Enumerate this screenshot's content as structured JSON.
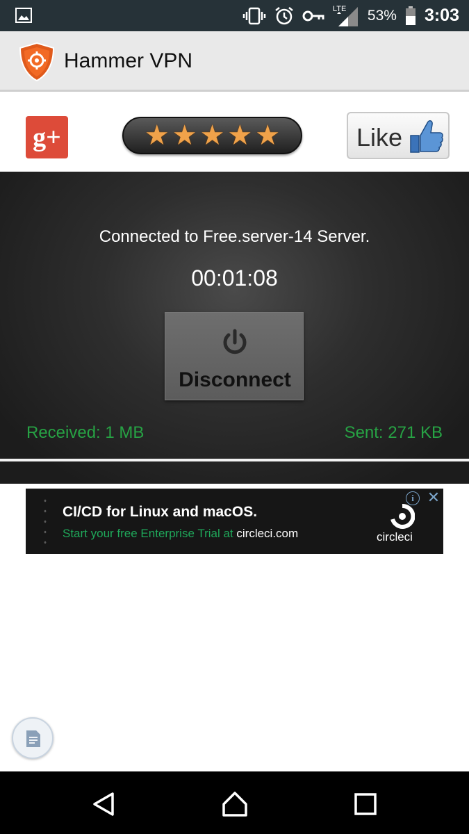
{
  "status_bar": {
    "battery": "53%",
    "time": "3:03",
    "network": "LTE"
  },
  "app": {
    "title": "Hammer VPN"
  },
  "social": {
    "gplus_label": "g+",
    "like_label": "Like",
    "rating_stars": 5
  },
  "connection": {
    "status": "Connected to Free.server-14 Server.",
    "timer": "00:01:08",
    "button_label": "Disconnect",
    "received": "Received: 1 MB",
    "sent": "Sent: 271 KB"
  },
  "ad": {
    "title": "CI/CD for Linux and macOS.",
    "subtitle_prefix": "Start your free Enterprise Trial at ",
    "subtitle_link": "circleci.com",
    "brand": "circleci"
  },
  "colors": {
    "accent_green": "#27a244",
    "star": "#f0a24a",
    "gplus": "#dd4b39"
  }
}
